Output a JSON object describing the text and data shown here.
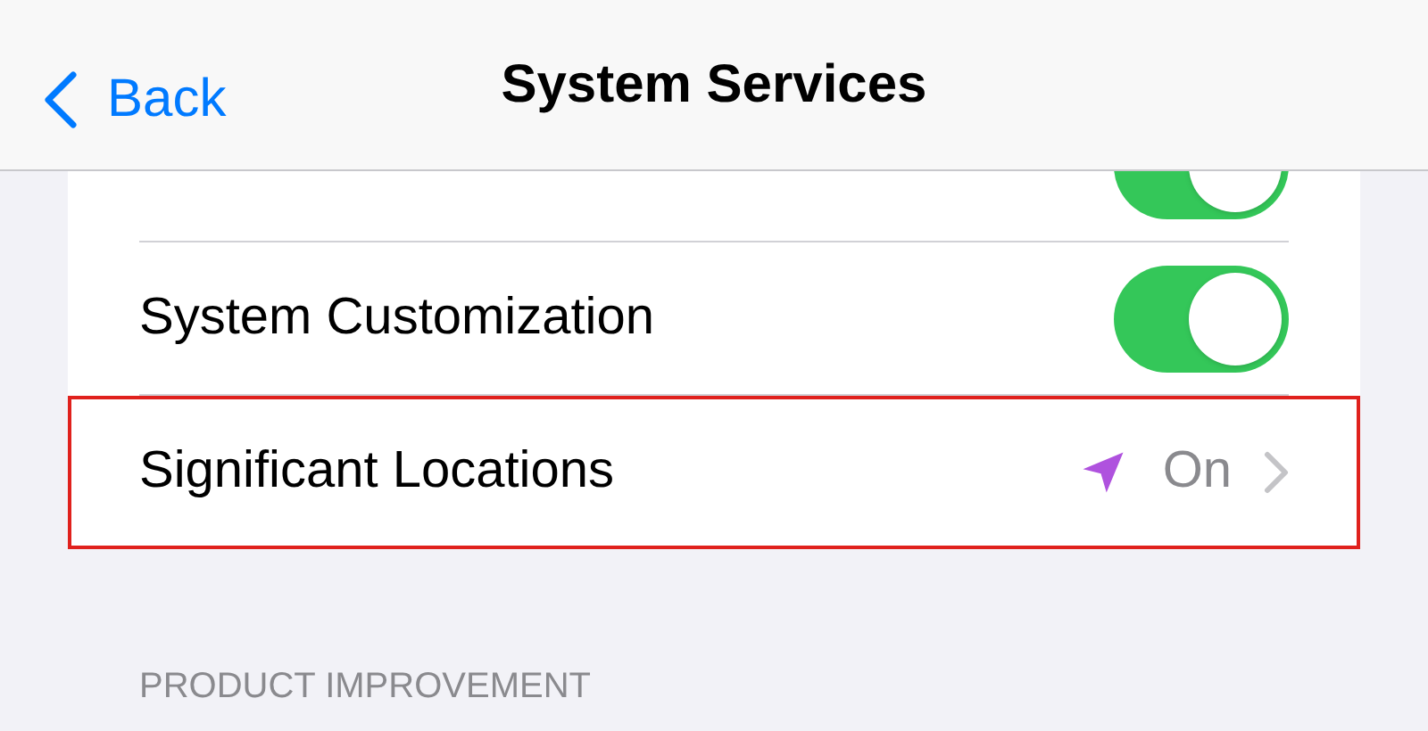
{
  "nav": {
    "back": "Back",
    "title": "System Services"
  },
  "rows": [
    {
      "kind": "toggle",
      "on": true,
      "highlighted": false
    },
    {
      "kind": "toggle",
      "label": "System Customization",
      "on": true,
      "highlighted": false
    },
    {
      "kind": "link",
      "label": "Significant Locations",
      "value": "On",
      "highlighted": true
    }
  ],
  "section_header": "PRODUCT IMPROVEMENT"
}
